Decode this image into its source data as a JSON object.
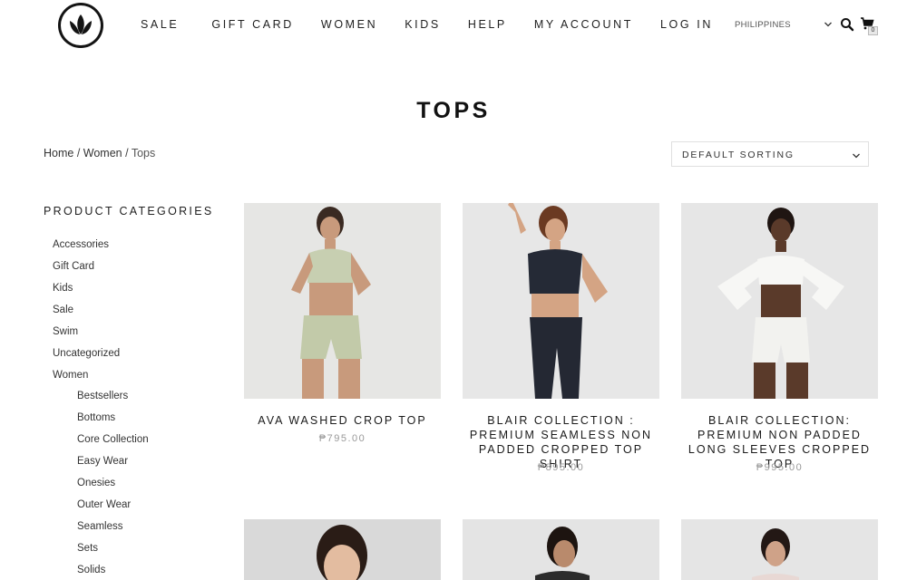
{
  "header": {
    "nav": [
      "SALE",
      "GIFT CARD",
      "WOMEN",
      "KIDS",
      "HELP",
      "MY ACCOUNT",
      "LOG IN"
    ],
    "country": "PHILIPPINES",
    "cart_count": "0"
  },
  "page": {
    "title": "TOPS",
    "breadcrumb": {
      "home": "Home",
      "sep1": " / ",
      "women": "Women",
      "sep2": " / ",
      "current": "Tops"
    },
    "sorting": "DEFAULT SORTING"
  },
  "sidebar": {
    "title": "PRODUCT CATEGORIES",
    "categories": [
      "Accessories",
      "Gift Card",
      "Kids",
      "Sale",
      "Swim",
      "Uncategorized",
      "Women"
    ],
    "subcategories": [
      "Bestsellers",
      "Bottoms",
      "Core Collection",
      "Easy Wear",
      "Onesies",
      "Outer Wear",
      "Seamless",
      "Sets",
      "Solids"
    ]
  },
  "products": [
    {
      "name": "AVA WASHED CROP TOP",
      "price": "₱795.00"
    },
    {
      "name": "BLAIR COLLECTION : PREMIUM SEAMLESS NON PADDED CROPPED TOP SHIRT",
      "price": "₱895.00"
    },
    {
      "name": "BLAIR COLLECTION: PREMIUM NON PADDED LONG SLEEVES CROPPED TOP",
      "price": "₱995.00"
    }
  ],
  "colors": {
    "text": "#222222",
    "price": "#999999",
    "image_bg": "#e5e5e5",
    "logo": "#141414"
  },
  "icons": [
    "lotus-logo-icon",
    "chevron-down-icon",
    "search-icon",
    "cart-icon"
  ]
}
